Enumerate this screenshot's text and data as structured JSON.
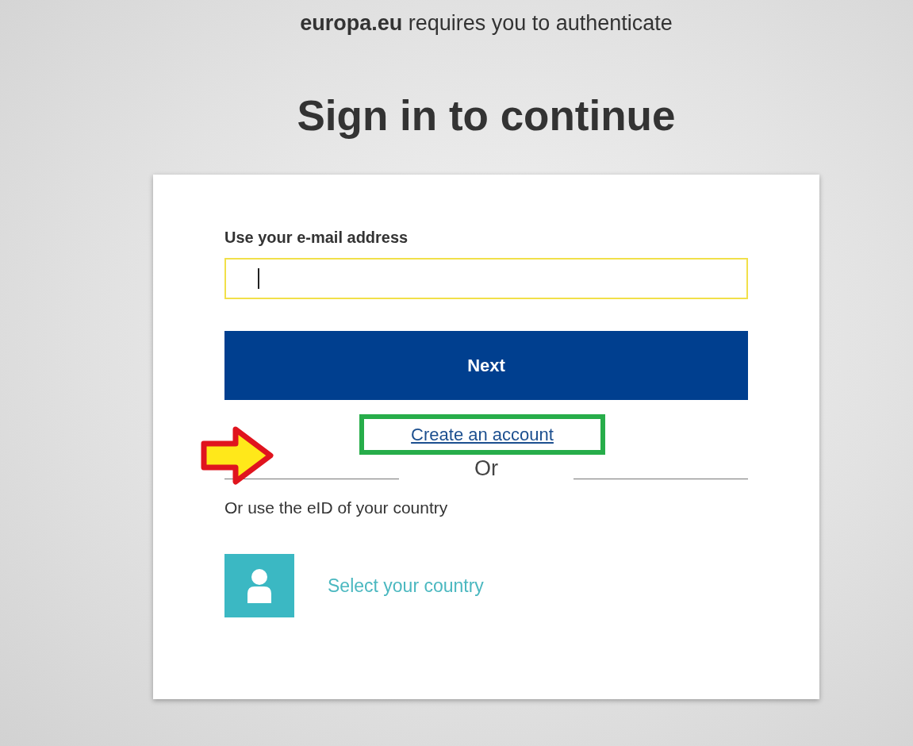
{
  "header": {
    "notice": "**europa.eu** requires you to authenticate",
    "title": "Sign in to continue"
  },
  "form": {
    "email_label": "Use your e-mail address",
    "email_field": {
      "focused": true
    },
    "next_button": "Next",
    "create_account_link": "Create an account",
    "create_account_highlighted": true,
    "separator": "Or",
    "eid_label": "Or use the eID of your country",
    "country_link": "Select your country"
  }
}
